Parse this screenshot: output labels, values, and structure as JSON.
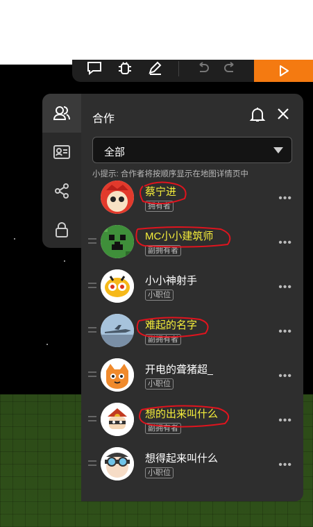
{
  "toolbar": {
    "icons": [
      "comment-icon",
      "bug-icon",
      "edit-icon",
      "undo-icon",
      "redo-icon"
    ],
    "play_icon": "play-icon",
    "accent": "#f47a11"
  },
  "sidebar": {
    "items": [
      {
        "icon": "users-icon",
        "active": true
      },
      {
        "icon": "id-card-icon",
        "active": false
      },
      {
        "icon": "share-icon",
        "active": false
      },
      {
        "icon": "lock-icon",
        "active": false
      }
    ]
  },
  "panel": {
    "title": "合作",
    "filter": {
      "selected": "全部"
    },
    "hint": "小提示: 合作者将按顺序显示在地图详情页中"
  },
  "collaborators": [
    {
      "name": "蔡宁进",
      "role": "拥有者",
      "highlight": true,
      "avatar": "red-mascot"
    },
    {
      "name": "MC小小建筑师",
      "role": "副拥有者",
      "highlight": true,
      "avatar": "creeper"
    },
    {
      "name": "小小神射手",
      "role": "小职位",
      "highlight": false,
      "avatar": "yellow-robot"
    },
    {
      "name": "难起的名字",
      "role": "副拥有者",
      "highlight": true,
      "avatar": "fighter-jet"
    },
    {
      "name": "开电的聋猪超_",
      "role": "小职位",
      "highlight": false,
      "avatar": "orange-cat"
    },
    {
      "name": "想的出来叫什么",
      "role": "副拥有者",
      "highlight": true,
      "avatar": "samurai"
    },
    {
      "name": "想得起来叫什么",
      "role": "小职位",
      "highlight": false,
      "avatar": "goggles-kid"
    }
  ],
  "more_label": "•••",
  "colors": {
    "highlight_text": "#f6ef3b",
    "annotation": "#e0141e",
    "panel_bg": "#2e2e2e"
  }
}
